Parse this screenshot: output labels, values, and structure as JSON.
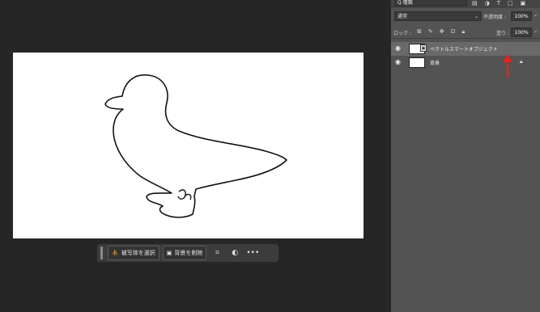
{
  "layers_panel": {
    "filter_kind": "Q 種類",
    "blend_mode": "通常",
    "opacity_label": "不透明度 :",
    "opacity_value": "100%",
    "lock_label": "ロック :",
    "fill_label": "塗り :",
    "fill_value": "100%",
    "layers": [
      {
        "name": "ベクトルスマートオブジェクト",
        "selected": true,
        "icon": "smart-object"
      },
      {
        "name": "背景",
        "selected": false,
        "locked": true
      }
    ]
  },
  "context_bar": {
    "select_subject": "被写体を選択",
    "remove_background": "背景を削除",
    "more": "•••"
  },
  "colors": {
    "workspace": "#262626",
    "panel": "#535353",
    "selected_layer": "#696969",
    "annotation_arrow": "#e0261b",
    "duck_outline": "#111111"
  }
}
